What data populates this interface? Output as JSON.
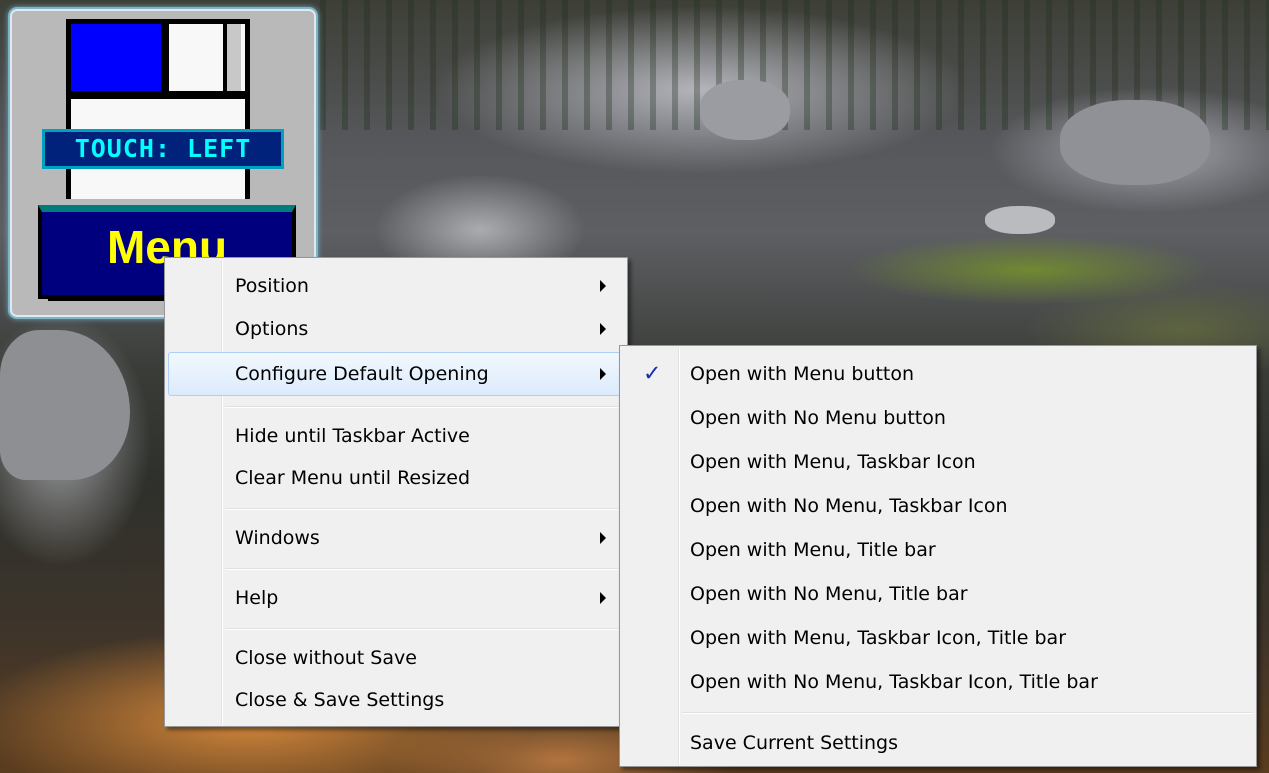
{
  "gadget": {
    "status_text": "TOUCH: LEFT",
    "menu_button_label": "Menu"
  },
  "context_menu": {
    "items": [
      {
        "label": "Position",
        "submenu": true
      },
      {
        "label": "Options",
        "submenu": true
      },
      {
        "label": "Configure Default Opening",
        "submenu": true,
        "highlighted": true
      },
      {
        "label": "Hide until Taskbar Active"
      },
      {
        "label": "Clear Menu until Resized"
      },
      {
        "label": "Windows",
        "submenu": true
      },
      {
        "label": "Help",
        "submenu": true
      },
      {
        "label": "Close without Save"
      },
      {
        "label": "Close & Save Settings"
      }
    ]
  },
  "submenu": {
    "check_glyph": "✓",
    "items": [
      {
        "label": "Open with Menu button",
        "checked": true
      },
      {
        "label": "Open with No Menu button"
      },
      {
        "label": "Open with Menu, Taskbar Icon"
      },
      {
        "label": "Open with No Menu, Taskbar Icon"
      },
      {
        "label": "Open with Menu, Title bar"
      },
      {
        "label": "Open with No Menu, Title bar"
      },
      {
        "label": "Open with Menu, Taskbar Icon, Title bar"
      },
      {
        "label": "Open with No Menu, Taskbar Icon, Title bar"
      },
      {
        "label": "Save Current Settings"
      }
    ]
  },
  "colors": {
    "highlight_border": "#aecff7",
    "check_color": "#1a2fb0",
    "gadget_button_text": "#ffff00",
    "gadget_status_text": "#00ffff"
  }
}
